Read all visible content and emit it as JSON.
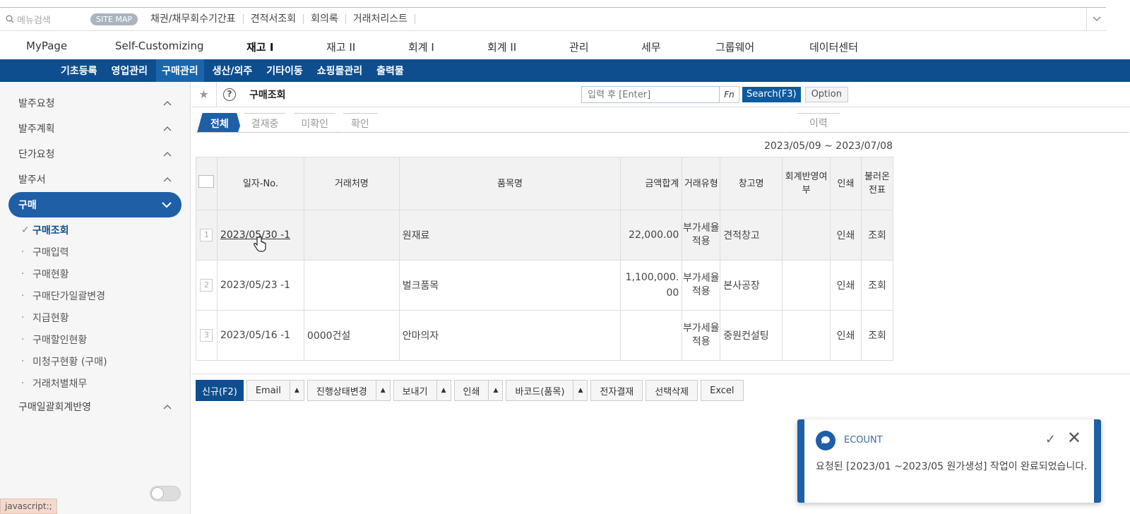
{
  "top_bar": {
    "search_placeholder": "메뉴검색",
    "sitemap": "SITE MAP",
    "quick_links": [
      "채권/채무회수기간표",
      "견적서조회",
      "회의록",
      "거래처리스트"
    ]
  },
  "main_nav": [
    "MyPage",
    "Self-Customizing",
    "재고 I",
    "재고 II",
    "회계 I",
    "회계 II",
    "관리",
    "세무",
    "그룹웨어",
    "데이터센터"
  ],
  "sub_nav": [
    "기초등록",
    "영업관리",
    "구매관리",
    "생산/외주",
    "기타이동",
    "쇼핑몰관리",
    "출력물"
  ],
  "sidebar": {
    "groups_top": [
      "발주요청",
      "발주계획",
      "단가요청",
      "발주서"
    ],
    "active_group": "구매",
    "sub_items": [
      "구매조회",
      "구매입력",
      "구매현황",
      "구매단가일괄변경",
      "지급현황",
      "구매할인현황",
      "미청구현황 (구매)",
      "거래처별채무"
    ],
    "groups_bottom": [
      "구매일괄회계반영"
    ],
    "status_url": "javascript:;"
  },
  "toolbar": {
    "title": "구매조회",
    "search_placeholder": "입력 후 [Enter]",
    "fn": "Fn",
    "search": "Search(F3)",
    "option": "Option"
  },
  "tabs": [
    "전체",
    "결재중",
    "미확인",
    "확인"
  ],
  "history_tab": "이력",
  "date_range": "2023/05/09 ~ 2023/07/08",
  "table": {
    "headers": [
      "일자-No.",
      "거래처명",
      "품목명",
      "금액합계",
      "거래유형",
      "창고명",
      "회계반영여부",
      "인쇄",
      "불러온 전표"
    ],
    "rows": [
      {
        "num": "1",
        "date": "2023/05/30 -1",
        "vendor": "",
        "item": "원재료",
        "amount": "22,000.00",
        "type": "부가세율 적용",
        "warehouse": "견적창고",
        "acct": "",
        "print": "인쇄",
        "load": "조회"
      },
      {
        "num": "2",
        "date": "2023/05/23 -1",
        "vendor": "",
        "item": "벌크품목",
        "amount": "1,100,000.00",
        "type": "부가세율 적용",
        "warehouse": "본사공장",
        "acct": "",
        "print": "인쇄",
        "load": "조회"
      },
      {
        "num": "3",
        "date": "2023/05/16 -1",
        "vendor": "0000건설",
        "item": "안마의자",
        "amount": "",
        "type": "부가세율 적용",
        "warehouse": "중원컨설팅",
        "acct": "",
        "print": "인쇄",
        "load": "조회"
      }
    ]
  },
  "bottom_buttons": {
    "new": "신규(F2)",
    "email": "Email",
    "status": "진행상태변경",
    "send": "보내기",
    "print": "인쇄",
    "barcode": "바코드(품목)",
    "approval": "전자결재",
    "delete": "선택삭제",
    "excel": "Excel"
  },
  "toast": {
    "title": "ECOUNT",
    "message": "요청된 [2023/01 ~2023/05 원가생성] 작업이 완료되었습니다."
  }
}
